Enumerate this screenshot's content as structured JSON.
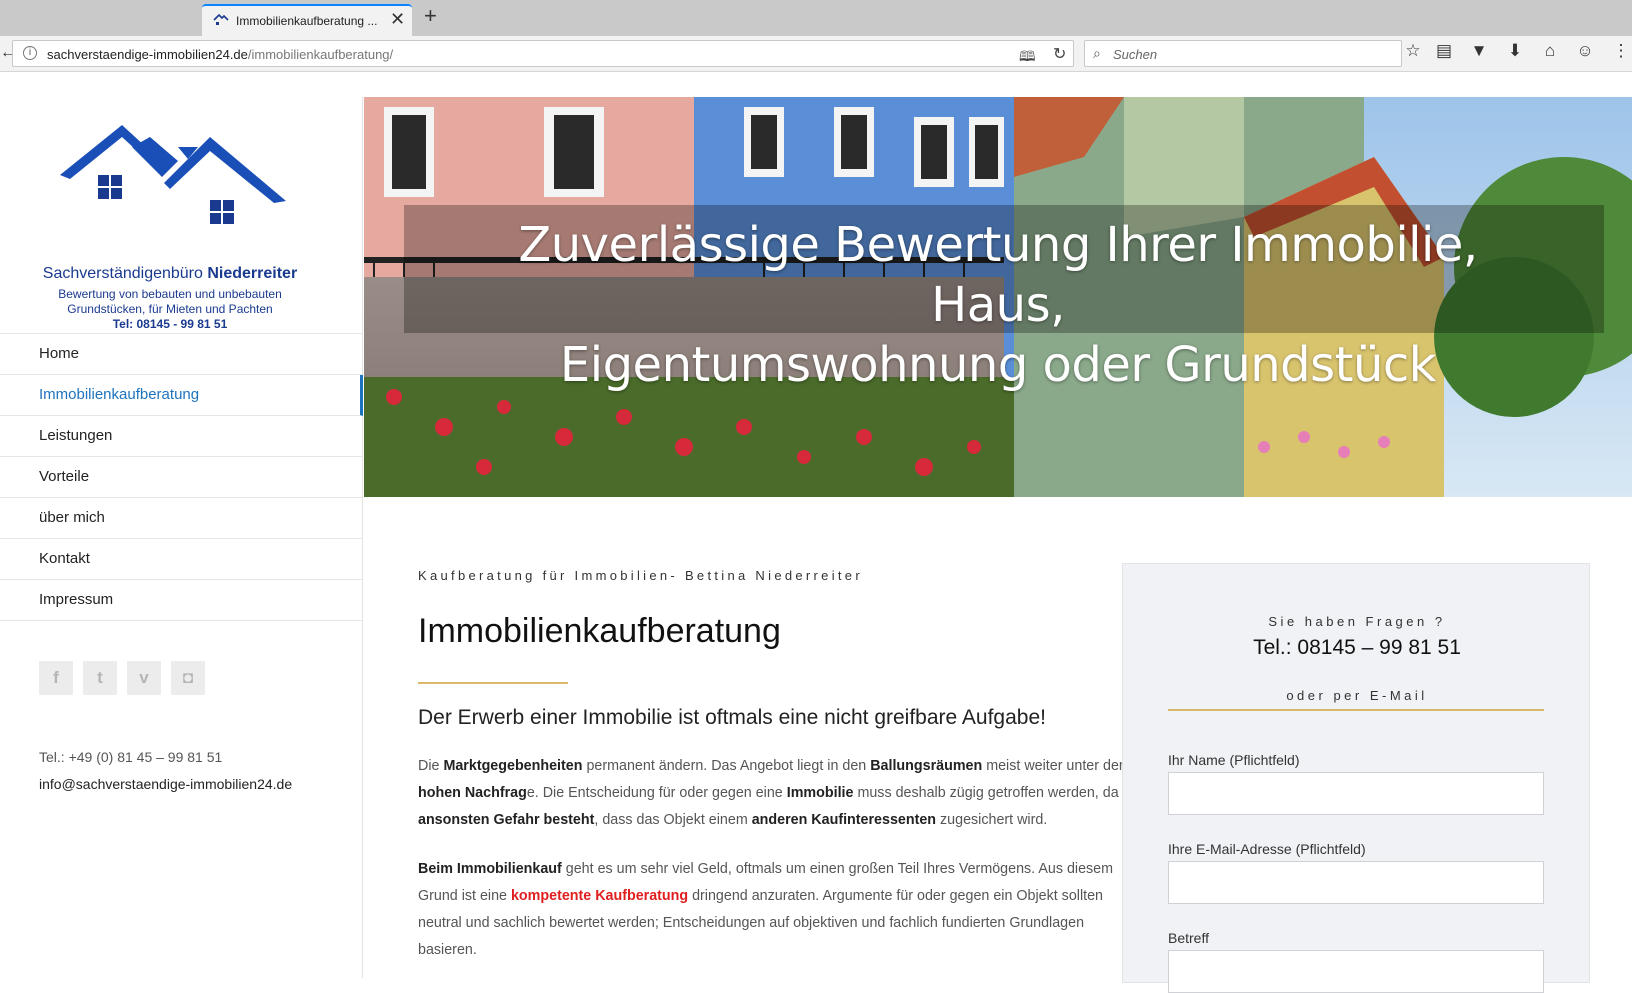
{
  "browser": {
    "tab_title": "Immobilienkaufberatung ...",
    "tab_close": "✕",
    "new_tab": "+",
    "url_domain": "sachverstaendige-immobilien24.de",
    "url_path": "/immobilienkaufberatung/",
    "search_placeholder": "Suchen",
    "icons": [
      "star-icon",
      "reading-list-icon",
      "pocket-icon",
      "download-icon",
      "home-icon",
      "smiley-icon",
      "menu-icon"
    ]
  },
  "sidebar": {
    "logo_name_regular": "Sachverständigenbüro ",
    "logo_name_bold": "Niederreiter",
    "logo_sub1": "Bewertung von bebauten und unbebauten",
    "logo_sub2": "Grundstücken, für Mieten und Pachten",
    "logo_tel": "Tel: 08145 - 99 81 51",
    "menu": [
      {
        "label": "Home"
      },
      {
        "label": "Immobilienkaufberatung"
      },
      {
        "label": "Leistungen"
      },
      {
        "label": "Vorteile"
      },
      {
        "label": "über mich"
      },
      {
        "label": "Kontakt"
      },
      {
        "label": "Impressum"
      }
    ],
    "social": [
      {
        "icon": "facebook-icon",
        "glyph": "f"
      },
      {
        "icon": "twitter-icon",
        "glyph": "t"
      },
      {
        "icon": "vimeo-icon",
        "glyph": "v"
      },
      {
        "icon": "instagram-icon",
        "glyph": "◘"
      }
    ],
    "contact_tel": "Tel.: +49 (0) 81 45 – 99 81 51",
    "contact_mail": "info@sachverstaendige-immobilien24.de"
  },
  "hero": {
    "title_line1": "Zuverlässige Bewertung Ihrer Immobilie, Haus,",
    "title_line2": "Eigentumswohnung oder Grundstück"
  },
  "main": {
    "kicker": "Kaufberatung für Immobilien- Bettina Niederreiter",
    "title": "Immobilienkaufberatung",
    "lead": "Der Erwerb einer Immobilie ist oftmals eine nicht greifbare Aufgabe!",
    "p1": [
      {
        "t": "Die ",
        "s": "n"
      },
      {
        "t": "Marktgegebenheiten",
        "s": "b"
      },
      {
        "t": " permanent ändern. Das Angebot liegt in den ",
        "s": "n"
      },
      {
        "t": "Ballungsräumen",
        "s": "b"
      },
      {
        "t": " meist weiter unter der ",
        "s": "n"
      },
      {
        "t": "hohen Nachfrag",
        "s": "b"
      },
      {
        "t": "e. Die Entscheidung für oder gegen eine ",
        "s": "n"
      },
      {
        "t": "Immobilie",
        "s": "b"
      },
      {
        "t": " muss deshalb zügig getroffen werden, da ",
        "s": "n"
      },
      {
        "t": "ansonsten Gefahr besteht",
        "s": "b"
      },
      {
        "t": ", dass das Objekt einem ",
        "s": "n"
      },
      {
        "t": "anderen Kaufinteressenten",
        "s": "b"
      },
      {
        "t": " zugesichert wird.",
        "s": "n"
      }
    ],
    "p2": [
      {
        "t": "Beim Immobilienkauf",
        "s": "b"
      },
      {
        "t": " geht es um sehr viel Geld, oftmals um einen großen Teil Ihres Vermögens. Aus diesem Grund ist eine ",
        "s": "n"
      },
      {
        "t": "kompetente Kaufberatung",
        "s": "r"
      },
      {
        "t": " dringend anzuraten. Argumente für oder gegen ein Objekt sollten neutral und sachlich bewertet werden; Entscheidungen auf objektiven und fachlich fundierten Grundlagen basieren.",
        "s": "n"
      }
    ]
  },
  "widget": {
    "question": "Sie haben Fragen ?",
    "tel": "Tel.: 08145 – 99 81 51",
    "or_mail": "oder per E-Mail",
    "name_label": "Ihr Name (Pflichtfeld)",
    "email_label": "Ihre E-Mail-Adresse (Pflichtfeld)",
    "subject_label": "Betreff"
  }
}
